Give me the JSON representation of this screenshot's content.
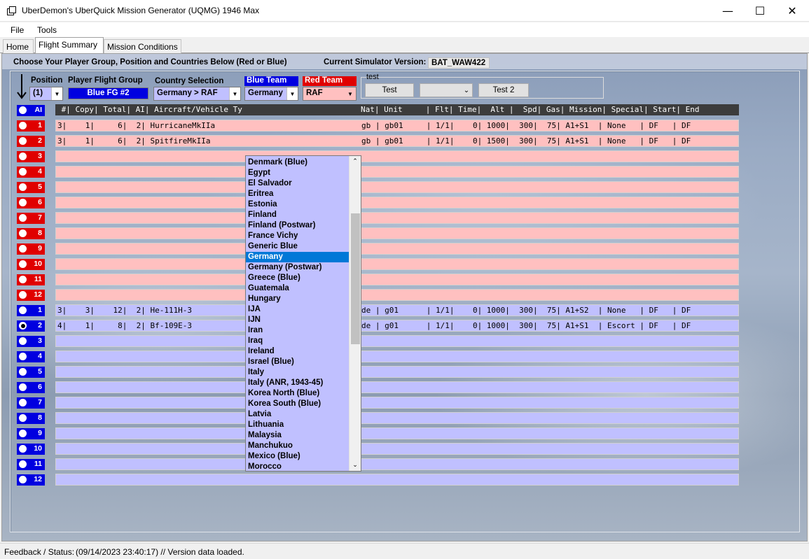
{
  "window": {
    "title": "UberDemon's UberQuick Mission Generator (UQMG) 1946 Max",
    "minimize": "—",
    "maximize": "☐",
    "close": "✕"
  },
  "menu": [
    "File",
    "Tools"
  ],
  "tabs": [
    "Home",
    "Flight Summary",
    "Mission Conditions"
  ],
  "header": {
    "instruction": "Choose Your Player Group, Position and Countries Below (Red or Blue)",
    "sim_version_label": "Current Simulator Version:",
    "sim_version_value": "BAT_WAW422"
  },
  "controls": {
    "position_label": "Position",
    "position_value": "(1)",
    "player_group_label": "Player Flight Group",
    "player_group_value": "Blue FG #2",
    "country_selection_label": "Country Selection",
    "country_selection_value": "Germany > RAF",
    "blue_team_label": "Blue Team",
    "blue_team_value": "Germany",
    "red_team_label": "Red Team",
    "red_team_value": "RAF",
    "test_group_label": "test",
    "test_button": "Test",
    "test_combo_value": "",
    "test2_button": "Test 2",
    "ai_label": "AI",
    "colors": {
      "blue": "#0000e0",
      "red": "#e00000",
      "red_row": "#ffc0c0",
      "blue_row": "#c0c0ff",
      "highlight": "#0078d7"
    }
  },
  "table": {
    "header": " #| Copy| Total| AI| Aircraft/Vehicle Ty",
    "header_right": "Nat| Unit     | Flt| Time|  Alt |  Spd| Gas| Mission| Special| Start| End",
    "red_rows": [
      {
        "num": "1",
        "left": "3|    1|     6|  2| HurricaneMkIIa",
        "right": "gb | gb01     | 1/1|    0| 1000|  300|  75| A1+S1  | None   | DF   | DF"
      },
      {
        "num": "2",
        "left": "3|    1|     6|  2| SpitfireMkIIa",
        "right": "gb | gb01     | 1/1|    0| 1500|  300|  75| A1+S1  | None   | DF   | DF"
      },
      {
        "num": "3",
        "left": "",
        "right": ""
      },
      {
        "num": "4",
        "left": "",
        "right": ""
      },
      {
        "num": "5",
        "left": "",
        "right": ""
      },
      {
        "num": "6",
        "left": "",
        "right": ""
      },
      {
        "num": "7",
        "left": "",
        "right": ""
      },
      {
        "num": "8",
        "left": "",
        "right": ""
      },
      {
        "num": "9",
        "left": "",
        "right": ""
      },
      {
        "num": "10",
        "left": "",
        "right": ""
      },
      {
        "num": "11",
        "left": "",
        "right": ""
      },
      {
        "num": "12",
        "left": "",
        "right": ""
      }
    ],
    "blue_rows": [
      {
        "num": "1",
        "left": "3|    3|    12|  2| He-111H-3",
        "right": "de | g01      | 1/1|    0| 1000|  300|  75| A1+S2  | None   | DF   | DF"
      },
      {
        "num": "2",
        "left": "4|    1|     8|  2| Bf-109E-3",
        "right": "de | g01      | 1/1|    0| 1000|  300|  75| A1+S1  | Escort | DF   | DF"
      },
      {
        "num": "3",
        "left": "",
        "right": ""
      },
      {
        "num": "4",
        "left": "",
        "right": ""
      },
      {
        "num": "5",
        "left": "",
        "right": ""
      },
      {
        "num": "6",
        "left": "",
        "right": ""
      },
      {
        "num": "7",
        "left": "",
        "right": ""
      },
      {
        "num": "8",
        "left": "",
        "right": ""
      },
      {
        "num": "9",
        "left": "",
        "right": ""
      },
      {
        "num": "10",
        "left": "",
        "right": ""
      },
      {
        "num": "11",
        "left": "",
        "right": ""
      },
      {
        "num": "12",
        "left": "",
        "right": ""
      }
    ]
  },
  "dropdown": {
    "items": [
      "Denmark (Blue)",
      "Egypt",
      "El Salvador",
      "Eritrea",
      "Estonia",
      "Finland",
      "Finland (Postwar)",
      "France Vichy",
      "Generic Blue",
      "Germany",
      "Germany (Postwar)",
      "Greece (Blue)",
      "Guatemala",
      "Hungary",
      "IJA",
      "IJN",
      "Iran",
      "Iraq",
      "Ireland",
      "Israel (Blue)",
      "Italy",
      "Italy (ANR, 1943-45)",
      "Korea North (Blue)",
      "Korea South (Blue)",
      "Latvia",
      "Lithuania",
      "Malaysia",
      "Manchukuo",
      "Mexico (Blue)",
      "Morocco"
    ],
    "selected": "Germany"
  },
  "status": {
    "label": "Feedback / Status:",
    "message": "(09/14/2023 23:40:17) // Version data loaded."
  }
}
